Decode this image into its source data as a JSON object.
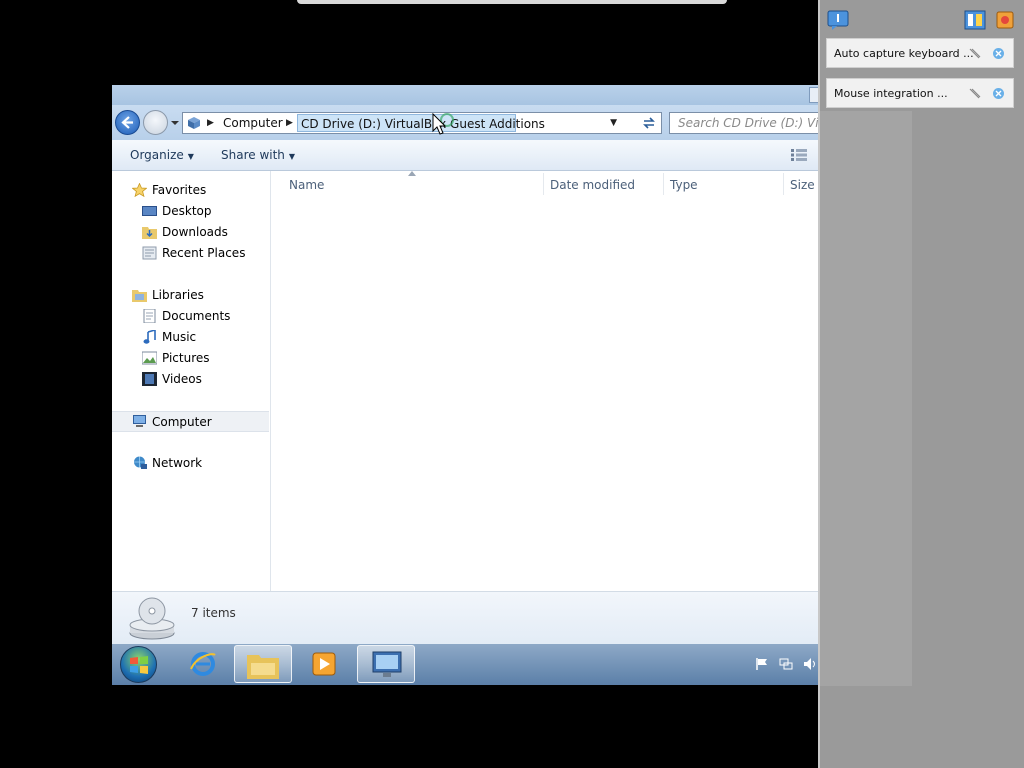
{
  "address": {
    "crumbs": [
      "Computer",
      "CD Drive (D:) VirtualBox Guest Additions"
    ],
    "search_placeholder": "Search CD Drive (D:) VirtualBox Guest Additions"
  },
  "commands": {
    "organize": "Organize",
    "share": "Share with"
  },
  "nav": {
    "favorites": "Favorites",
    "desktop": "Desktop",
    "downloads": "Downloads",
    "recent": "Recent Places",
    "libraries": "Libraries",
    "documents": "Documents",
    "music": "Music",
    "pictures": "Pictures",
    "videos": "Videos",
    "computer": "Computer",
    "network": "Network"
  },
  "columns": [
    "Name",
    "Date modified",
    "Type",
    "Size"
  ],
  "details": {
    "count": "7 items"
  },
  "vbox": {
    "notice1": "Auto capture keyboard ...",
    "notice2": "Mouse integration ..."
  },
  "colors": {
    "accent": "#1c5cb7",
    "selection": "#cde4f7",
    "panel": "#9a9a9a"
  }
}
